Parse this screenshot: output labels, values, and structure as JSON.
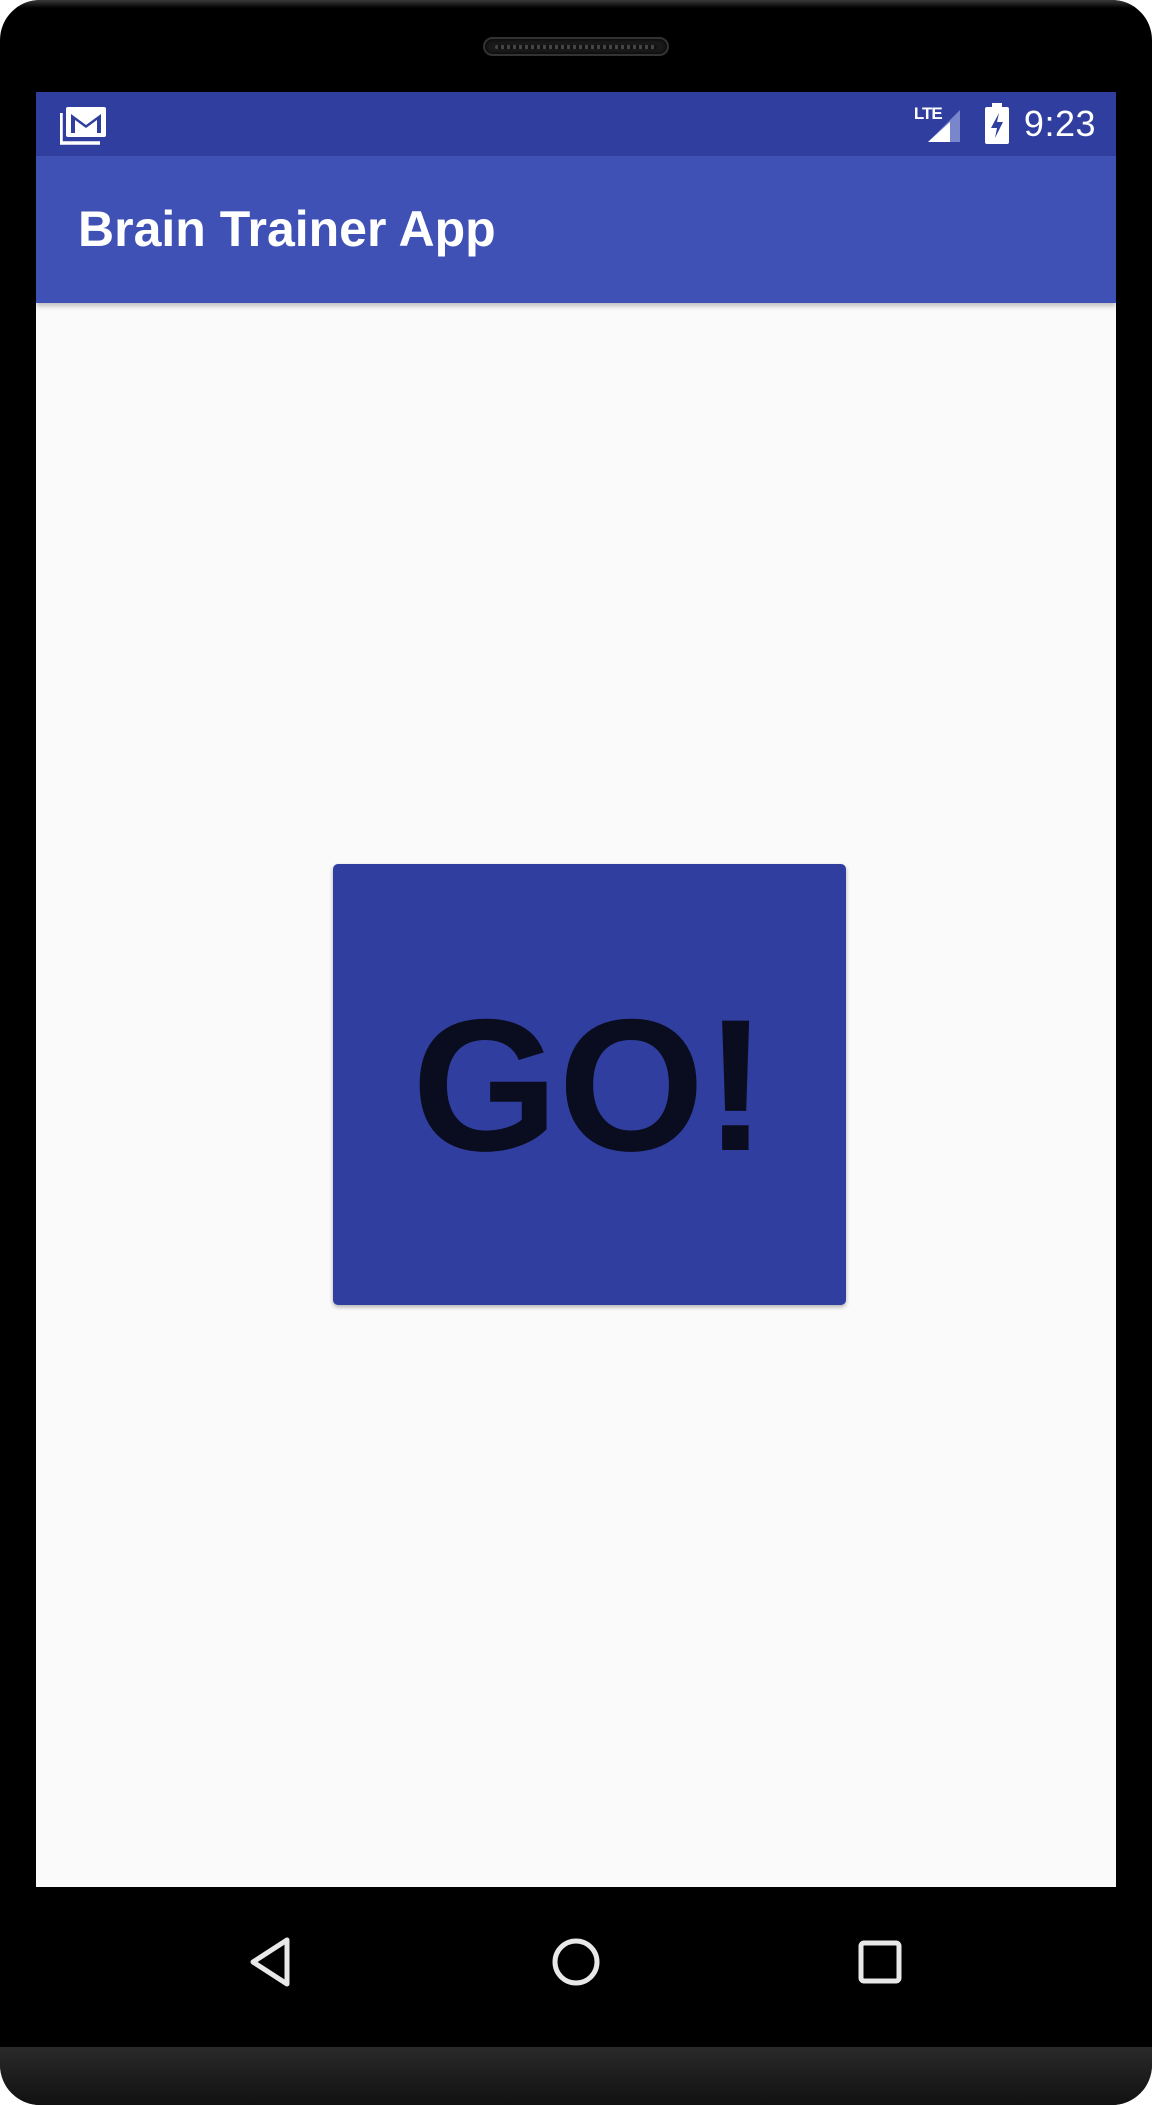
{
  "status_bar": {
    "notification_icon": "gmail-icon",
    "network_label": "LTE",
    "signal_icon": "signal-icon",
    "battery_icon": "battery-charging-icon",
    "time": "9:23"
  },
  "app_bar": {
    "title": "Brain Trainer App"
  },
  "main": {
    "go_button_label": "GO!"
  },
  "nav_bar": {
    "back_icon": "back-icon",
    "home_icon": "home-icon",
    "recents_icon": "recents-icon"
  },
  "colors": {
    "primary": "#3f51b5",
    "primary_dark": "#303f9f",
    "background": "#fafafa",
    "button_text": "#0a0d1f"
  }
}
